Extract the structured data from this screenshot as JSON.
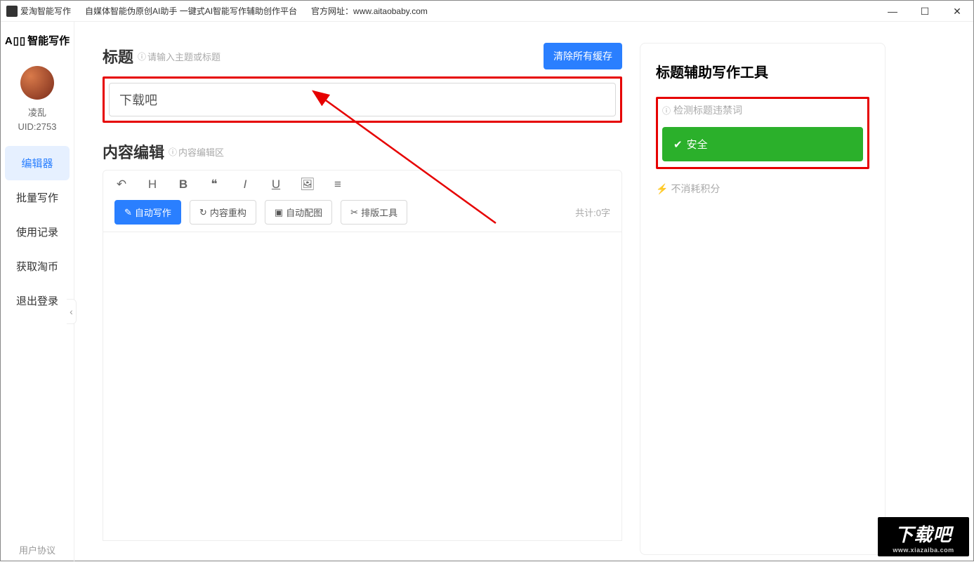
{
  "titlebar": {
    "app_name": "爱淘智能写作",
    "subtitle": "自媒体智能伪原创AI助手   一键式AI智能写作辅助创作平台",
    "url_label": "官方网址：",
    "url": "www.aitaobaby.com"
  },
  "sidebar": {
    "logo_text": "智能写作",
    "logo_prefix": "A▯▯",
    "username": "凌乱",
    "uid": "UID:2753",
    "items": [
      {
        "label": "编辑器",
        "active": true
      },
      {
        "label": "批量写作",
        "active": false
      },
      {
        "label": "使用记录",
        "active": false
      },
      {
        "label": "获取淘币",
        "active": false
      },
      {
        "label": "退出登录",
        "active": false
      }
    ],
    "footer": "用户协议"
  },
  "main": {
    "title_section": {
      "heading": "标题",
      "hint": "请输入主题或标题",
      "clear_button": "清除所有缓存",
      "input_value": "下载吧"
    },
    "content_section": {
      "heading": "内容编辑",
      "hint": "内容编辑区",
      "actions": {
        "auto_write": "自动写作",
        "rebuild": "内容重构",
        "auto_image": "自动配图",
        "layout_tool": "排版工具"
      },
      "word_count": "共计:0字"
    }
  },
  "right": {
    "heading": "标题辅助写作工具",
    "check_label": "检测标题违禁词",
    "safe_label": "安全",
    "points_label": "不消耗积分"
  },
  "watermark": {
    "big": "下载吧",
    "small": "www.xiazaiba.com"
  }
}
